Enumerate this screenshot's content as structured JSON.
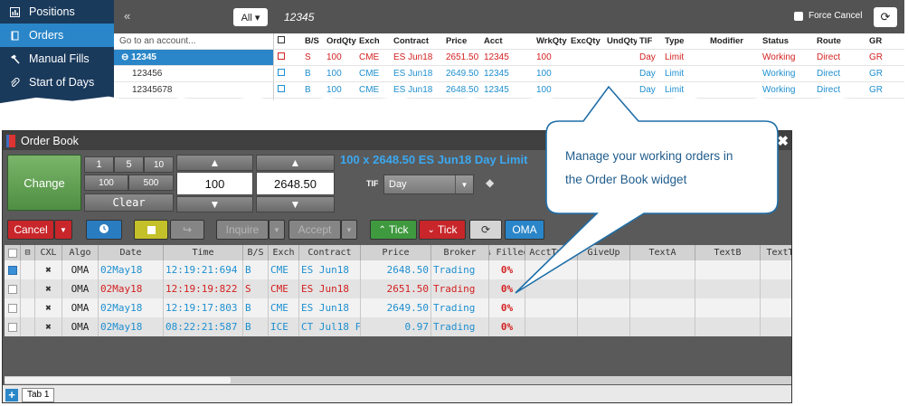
{
  "top_panel": {
    "nav": [
      {
        "label": "Positions",
        "icon": "chart-icon",
        "active": false
      },
      {
        "label": "Orders",
        "icon": "book-icon",
        "active": true
      },
      {
        "label": "Manual Fills",
        "icon": "hammer-icon",
        "active": false
      },
      {
        "label": "Start of Days",
        "icon": "paperclip-icon",
        "active": false
      }
    ],
    "collapse_glyph": "«",
    "all_button": "All ▾",
    "title": "12345",
    "force_cancel": "Force Cancel",
    "account_list": {
      "search_placeholder": "Go to an account...",
      "selected": "⊖ 12345",
      "children": [
        "123456",
        "12345678"
      ]
    },
    "orders_table": {
      "headers": [
        "",
        "B/S",
        "OrdQty",
        "Exch",
        "Contract",
        "Price",
        "Acct",
        "WrkQty",
        "ExcQty",
        "UndQty",
        "TIF",
        "Type",
        "Modifier",
        "Status",
        "Route",
        "GR"
      ],
      "rows": [
        {
          "color": "red",
          "cells": [
            "",
            "S",
            "100",
            "CME",
            "ES Jun18",
            "2651.50",
            "12345",
            "100",
            "",
            "",
            "Day",
            "Limit",
            "",
            "Working",
            "Direct",
            "GR"
          ]
        },
        {
          "color": "blue",
          "cells": [
            "",
            "B",
            "100",
            "CME",
            "ES Jun18",
            "2649.50",
            "12345",
            "100",
            "",
            "",
            "Day",
            "Limit",
            "",
            "Working",
            "Direct",
            "GR"
          ]
        },
        {
          "color": "blue",
          "cells": [
            "",
            "B",
            "100",
            "CME",
            "ES Jun18",
            "2648.50",
            "12345",
            "100",
            "",
            "",
            "Day",
            "Limit",
            "",
            "Working",
            "Direct",
            "GR"
          ]
        }
      ]
    }
  },
  "order_book": {
    "title": "Order Book",
    "close_glyph": "✖",
    "change_label": "Change",
    "qty_buttons": [
      "1",
      "5",
      "10",
      "100",
      "500"
    ],
    "clear_label": "Clear",
    "qty_value": "100",
    "price_value": "2648.50",
    "summary": "100 x 2648.50 ES Jun18 Day Limit",
    "tif_label": "TIF",
    "tif_value": "Day",
    "toolbar": {
      "cancel": "Cancel",
      "inquire": "Inquire",
      "accept": "Accept",
      "tick_up": "Tick",
      "tick_down": "Tick",
      "oma": "OMA"
    },
    "grid": {
      "headers": [
        "",
        "",
        "CXL",
        "Algo",
        "Date",
        "Time",
        "B/S",
        "Exch",
        "Contract",
        "Price",
        "Broker",
        "% Filled",
        "AcctType",
        "GiveUp",
        "TextA",
        "TextB",
        "TextTT"
      ],
      "rows": [
        {
          "color": "blue",
          "checked": true,
          "cxl": "✖",
          "algo": "OMA",
          "date": "02May18",
          "time": "12:19:21:694",
          "bs": "B",
          "exch": "CME",
          "contract": "ES Jun18",
          "price": "2648.50",
          "broker": "Trading",
          "filled": "0%"
        },
        {
          "color": "red",
          "checked": false,
          "cxl": "✖",
          "algo": "OMA",
          "date": "02May18",
          "time": "12:19:19:822",
          "bs": "S",
          "exch": "CME",
          "contract": "ES Jun18",
          "price": "2651.50",
          "broker": "Trading",
          "filled": "0%"
        },
        {
          "color": "blue",
          "checked": false,
          "cxl": "✖",
          "algo": "OMA",
          "date": "02May18",
          "time": "12:19:17:803",
          "bs": "B",
          "exch": "CME",
          "contract": "ES Jun18",
          "price": "2649.50",
          "broker": "Trading",
          "filled": "0%"
        },
        {
          "color": "blue",
          "checked": false,
          "cxl": "✖",
          "algo": "OMA",
          "date": "02May18",
          "time": "08:22:21:587",
          "bs": "B",
          "exch": "ICE",
          "contract": "CT Jul18 F",
          "price": "0.97",
          "broker": "Trading",
          "filled": "0%"
        }
      ]
    },
    "tab_add": "+",
    "tab_label": "Tab 1"
  },
  "callout": {
    "line1": "Manage your working orders in",
    "line2": "the Order Book widget"
  },
  "colors": {
    "nav_bg": "#1a3a5c",
    "nav_active": "#2a86c8",
    "sell_red": "#d42020",
    "buy_blue": "#1e8fd0",
    "callout_border": "#1f6fa8"
  }
}
